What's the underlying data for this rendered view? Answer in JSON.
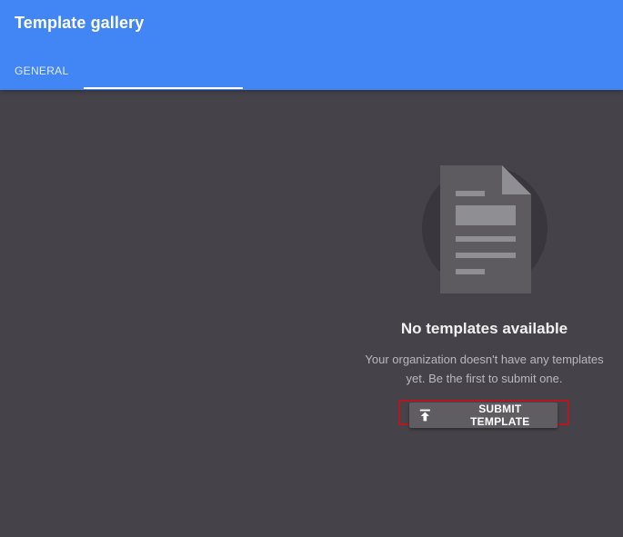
{
  "header": {
    "title": "Template gallery",
    "tab": "GENERAL",
    "accent_color": "#4285f4"
  },
  "empty_state": {
    "icon": "document-icon",
    "title": "No templates available",
    "description": "Your organization doesn't have any templates yet. Be the first to submit one."
  },
  "actions": {
    "submit_label": "SUBMIT TEMPLATE",
    "submit_icon": "upload-icon",
    "highlight_color": "#b2181d"
  }
}
